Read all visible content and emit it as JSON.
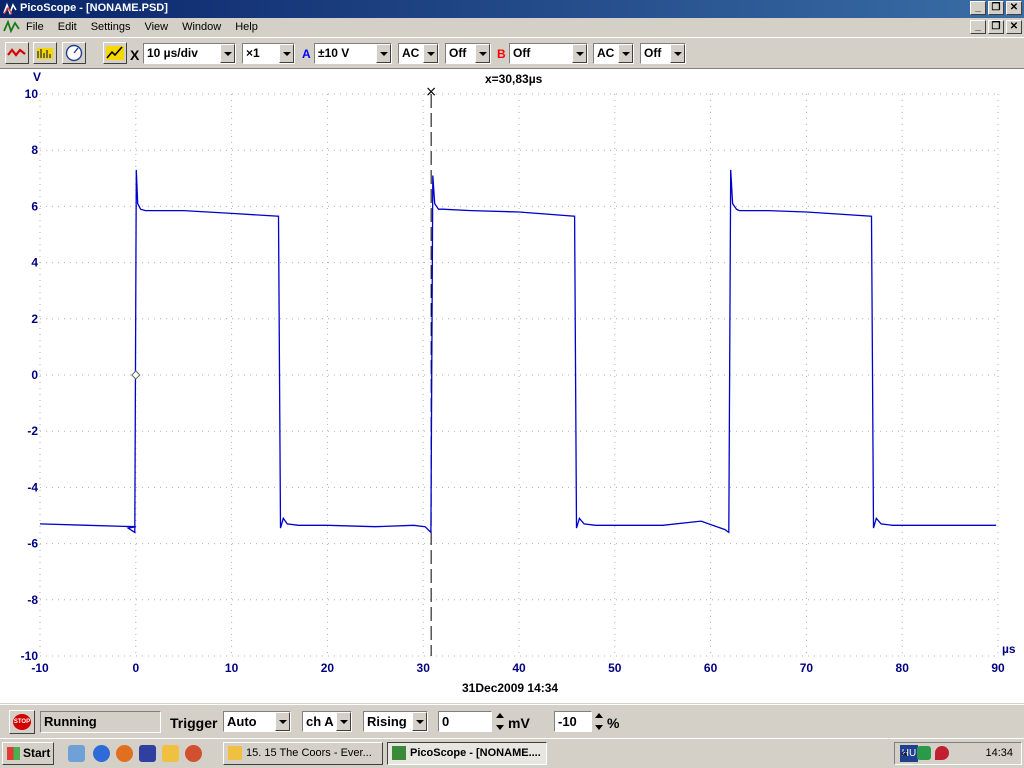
{
  "window": {
    "title": "PicoScope - [NONAME.PSD]",
    "minimize": "_",
    "restore": "❐",
    "close": "✕"
  },
  "menu": [
    "File",
    "Edit",
    "Settings",
    "View",
    "Window",
    "Help"
  ],
  "toolbar": {
    "timebase": "10 µs/div",
    "zoom": "×1",
    "channel_a_label": "A",
    "channel_a_range": "±10 V",
    "channel_a_coupling": "AC",
    "channel_a_extra": "Off",
    "channel_b_label": "B",
    "channel_b_range": "Off",
    "channel_b_coupling": "AC",
    "channel_b_extra": "Off",
    "cross_label": "X"
  },
  "colors": {
    "trace": "#0000cc",
    "axis_text": "#00007f",
    "grid": "#b0b0b0",
    "channel_a": "#0000ff",
    "channel_b": "#ff0000"
  },
  "chart_data": {
    "type": "line",
    "title": "",
    "xlabel": "µs",
    "ylabel": "V",
    "xlim": [
      -10,
      90
    ],
    "ylim": [
      -10,
      10
    ],
    "x_ticks": [
      "-10",
      "0",
      "10",
      "20",
      "30",
      "40",
      "50",
      "60",
      "70",
      "80",
      "90"
    ],
    "y_ticks": [
      "10",
      "8",
      "6",
      "4",
      "2",
      "0",
      "-2",
      "-4",
      "-6",
      "-8",
      "-10"
    ],
    "grid": true,
    "cursor_readout": "x=30,83µs",
    "cursor_x": 30.83,
    "trigger_marker": {
      "x": 0,
      "y": 0
    },
    "timestamp": "31Dec2009  14:34",
    "series": [
      {
        "points": [
          [
            -10,
            -5.3
          ],
          [
            -5,
            -5.35
          ],
          [
            0,
            -5.4
          ],
          [
            -0.8,
            -5.45
          ],
          [
            -0.1,
            -5.6
          ],
          [
            0.05,
            7.3
          ],
          [
            0.2,
            6.1
          ],
          [
            0.5,
            5.9
          ],
          [
            1,
            5.85
          ],
          [
            5,
            5.85
          ],
          [
            10,
            5.75
          ],
          [
            14.9,
            5.65
          ],
          [
            15.1,
            -5.45
          ],
          [
            15.4,
            -5.1
          ],
          [
            15.8,
            -5.3
          ],
          [
            17,
            -5.35
          ],
          [
            20,
            -5.35
          ],
          [
            25,
            -5.4
          ],
          [
            29,
            -5.35
          ],
          [
            30.2,
            -5.4
          ],
          [
            30.8,
            -5.6
          ],
          [
            31.0,
            7.1
          ],
          [
            31.2,
            6.1
          ],
          [
            31.6,
            5.9
          ],
          [
            32,
            5.9
          ],
          [
            35,
            5.85
          ],
          [
            40,
            5.8
          ],
          [
            45.8,
            5.65
          ],
          [
            46.0,
            -5.45
          ],
          [
            46.3,
            -5.1
          ],
          [
            46.8,
            -5.3
          ],
          [
            48,
            -5.35
          ],
          [
            55,
            -5.35
          ],
          [
            59,
            -5.2
          ],
          [
            61.5,
            -5.5
          ],
          [
            61.9,
            -5.6
          ],
          [
            62.1,
            7.3
          ],
          [
            62.3,
            6.1
          ],
          [
            62.7,
            5.9
          ],
          [
            63,
            5.85
          ],
          [
            66,
            5.85
          ],
          [
            70,
            5.8
          ],
          [
            76.8,
            5.65
          ],
          [
            77.0,
            -5.45
          ],
          [
            77.3,
            -5.1
          ],
          [
            77.8,
            -5.3
          ],
          [
            79,
            -5.35
          ],
          [
            85,
            -5.35
          ],
          [
            89.8,
            -5.35
          ]
        ]
      }
    ]
  },
  "status": {
    "running": "Running",
    "trigger_label": "Trigger",
    "trigger_mode": "Auto",
    "trigger_channel": "ch A",
    "trigger_edge": "Rising",
    "trigger_level": "0",
    "trigger_level_unit": "mV",
    "pretrigger": "-10",
    "pretrigger_unit": "%",
    "stop": "STOP"
  },
  "taskbar": {
    "start": "Start",
    "task1": "15. 15 The Coors - Ever...",
    "task2": "PicoScope - [NONAME....",
    "lang": "HU",
    "clock": "14:34",
    "chevron": "«"
  }
}
